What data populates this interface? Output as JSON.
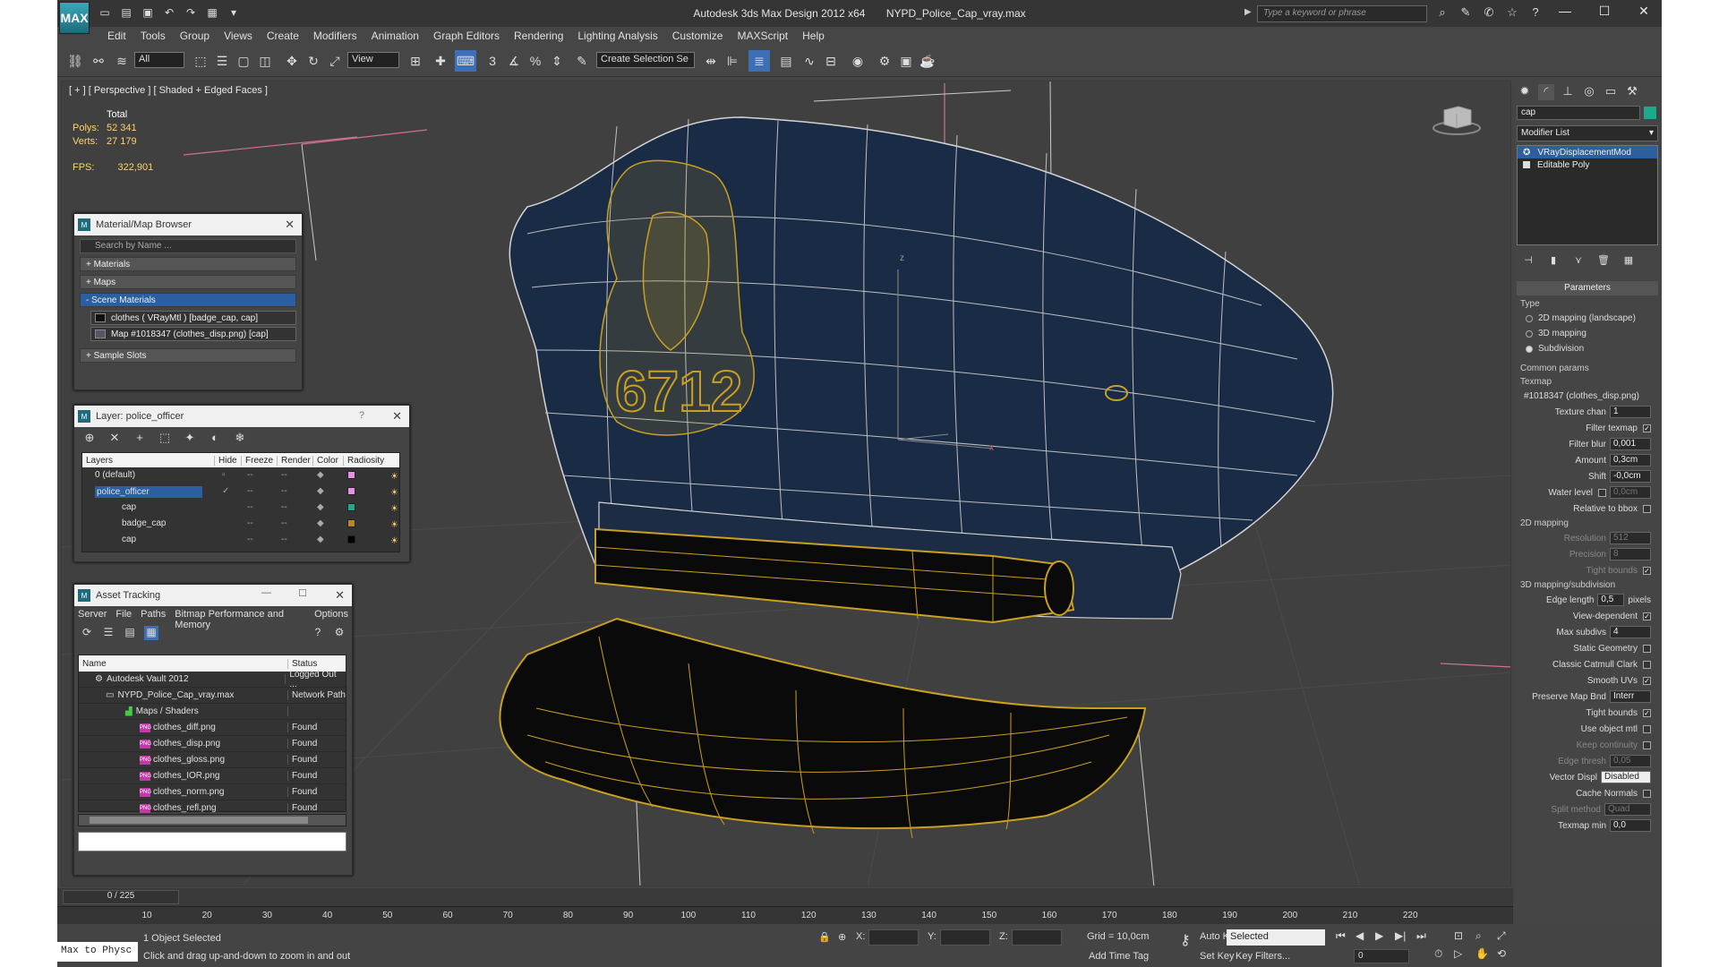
{
  "window": {
    "app_title": "Autodesk 3ds Max Design 2012 x64",
    "file_title": "NYPD_Police_Cap_vray.max",
    "search_placeholder": "Type a keyword or phrase",
    "logo": "MAX"
  },
  "menu": [
    "Edit",
    "Tools",
    "Group",
    "Views",
    "Create",
    "Modifiers",
    "Animation",
    "Graph Editors",
    "Rendering",
    "Lighting Analysis",
    "Customize",
    "MAXScript",
    "Help"
  ],
  "toolbar": {
    "filter_select": "All",
    "coord_select": "View",
    "selection_set": "Create Selection Se"
  },
  "viewport": {
    "label": "[ + ] [ Perspective ] [ Shaded + Edged Faces ]",
    "stats_header": "Total",
    "stats": [
      {
        "k": "Polys:",
        "v": "52 341"
      },
      {
        "k": "Verts:",
        "v": "27 179"
      }
    ],
    "fps_label": "FPS:",
    "fps_value": "322,901",
    "badge_text": "6712",
    "axis_z": "z",
    "axis_x": "x",
    "colors": {
      "cap": "#1a2b45",
      "wire": "#d4d4d4",
      "badge": "#c9a020",
      "brim": "#0a0a0a"
    }
  },
  "material_browser": {
    "title": "Material/Map Browser",
    "search": "Search by Name ...",
    "sections": [
      "+ Materials",
      "+ Maps",
      "- Scene Materials"
    ],
    "items": [
      "clothes  ( VRayMtl ) [badge_cap, cap]",
      "Map #1018347 (clothes_disp.png)  [cap]"
    ],
    "sample_slots": "+ Sample Slots"
  },
  "layer_manager": {
    "title": "Layer: police_officer",
    "help": "?",
    "columns": [
      "Layers",
      "Hide",
      "Freeze",
      "Render",
      "Color",
      "Radiosity"
    ],
    "rows": [
      {
        "name": "0 (default)",
        "color": "#e98ee9"
      },
      {
        "name": "police_officer",
        "color": "#e98ee9"
      },
      {
        "name": "cap",
        "color": "#1fa98a"
      },
      {
        "name": "badge_cap",
        "color": "#b5892a"
      },
      {
        "name": "cap",
        "color": "#000000"
      }
    ]
  },
  "asset_tracking": {
    "title": "Asset Tracking",
    "menu": [
      "Server",
      "File",
      "Paths",
      "Bitmap Performance and Memory",
      "Options"
    ],
    "columns": [
      "Name",
      "Status"
    ],
    "rows": [
      {
        "name": "Autodesk Vault 2012",
        "status": "Logged Out ..."
      },
      {
        "name": "NYPD_Police_Cap_vray.max",
        "status": "Network Path"
      },
      {
        "name": "Maps / Shaders",
        "status": ""
      },
      {
        "name": "clothes_diff.png",
        "status": "Found"
      },
      {
        "name": "clothes_disp.png",
        "status": "Found"
      },
      {
        "name": "clothes_gloss.png",
        "status": "Found"
      },
      {
        "name": "clothes_IOR.png",
        "status": "Found"
      },
      {
        "name": "clothes_norm.png",
        "status": "Found"
      },
      {
        "name": "clothes_refl.png",
        "status": "Found"
      }
    ]
  },
  "command_panel": {
    "object_name": "cap",
    "modifier_list": "Modifier List",
    "stack": [
      "VRayDisplacementMod",
      "Editable Poly"
    ],
    "rollout": "Parameters",
    "type_label": "Type",
    "types": [
      "2D mapping (landscape)",
      "3D mapping",
      "Subdivision"
    ],
    "common_params": "Common params",
    "texmap_label": "Texmap",
    "texmap_value": "#1018347 (clothes_disp.png)",
    "texture_chan": {
      "label": "Texture chan",
      "value": "1"
    },
    "filter_texmap": "Filter texmap",
    "filter_blur": {
      "label": "Filter blur",
      "value": "0,001"
    },
    "amount": {
      "label": "Amount",
      "value": "0,3cm"
    },
    "shift": {
      "label": "Shift",
      "value": "-0,0cm"
    },
    "water_level": {
      "label": "Water level",
      "value": "0,0cm"
    },
    "relative_bbox": "Relative to bbox",
    "mapping2d": "2D mapping",
    "resolution": {
      "label": "Resolution",
      "value": "512"
    },
    "precision": {
      "label": "Precision",
      "value": "8"
    },
    "tight_bounds": "Tight bounds",
    "mapping3d": "3D mapping/subdivision",
    "edge_length": {
      "label": "Edge length",
      "value": "0,5",
      "unit": "pixels"
    },
    "view_dependent": "View-dependent",
    "max_subdivs": {
      "label": "Max subdivs",
      "value": "4"
    },
    "static_geometry": "Static Geometry",
    "classic_catmull": "Classic Catmull Clark",
    "smooth_uvs": "Smooth UVs",
    "preserve_map": {
      "label": "Preserve Map Bnd",
      "value": "Interr"
    },
    "tight_bounds2": "Tight bounds",
    "use_object_mtl": "Use object mtl",
    "keep_continuity": "Keep continuity",
    "edge_thresh": {
      "label": "Edge thresh",
      "value": "0,05"
    },
    "vector_displ": {
      "label": "Vector Displ",
      "value": "Disabled"
    },
    "cache_normals": "Cache Normals",
    "split_method": {
      "label": "Split method",
      "value": "Quad"
    },
    "texmap_min": {
      "label": "Texmap min",
      "value": "0,0"
    }
  },
  "timeline": {
    "slider": "0 / 225",
    "ticks": [
      "10",
      "20",
      "30",
      "40",
      "50",
      "60",
      "70",
      "80",
      "90",
      "100",
      "110",
      "120",
      "130",
      "140",
      "150",
      "160",
      "170",
      "180",
      "190",
      "200",
      "210",
      "220"
    ]
  },
  "status": {
    "maxscript": "Max to Physc",
    "selected": "1 Object Selected",
    "prompt": "Click and drag up-and-down to zoom in and out",
    "x": "X:",
    "y": "Y:",
    "z": "Z:",
    "grid": "Grid = 10,0cm",
    "add_time_tag": "Add Time Tag",
    "auto_key": "Auto Key",
    "set_key": "Set Key",
    "key_mode": "Selected",
    "key_filters": "Key Filters...",
    "frame": "0"
  }
}
